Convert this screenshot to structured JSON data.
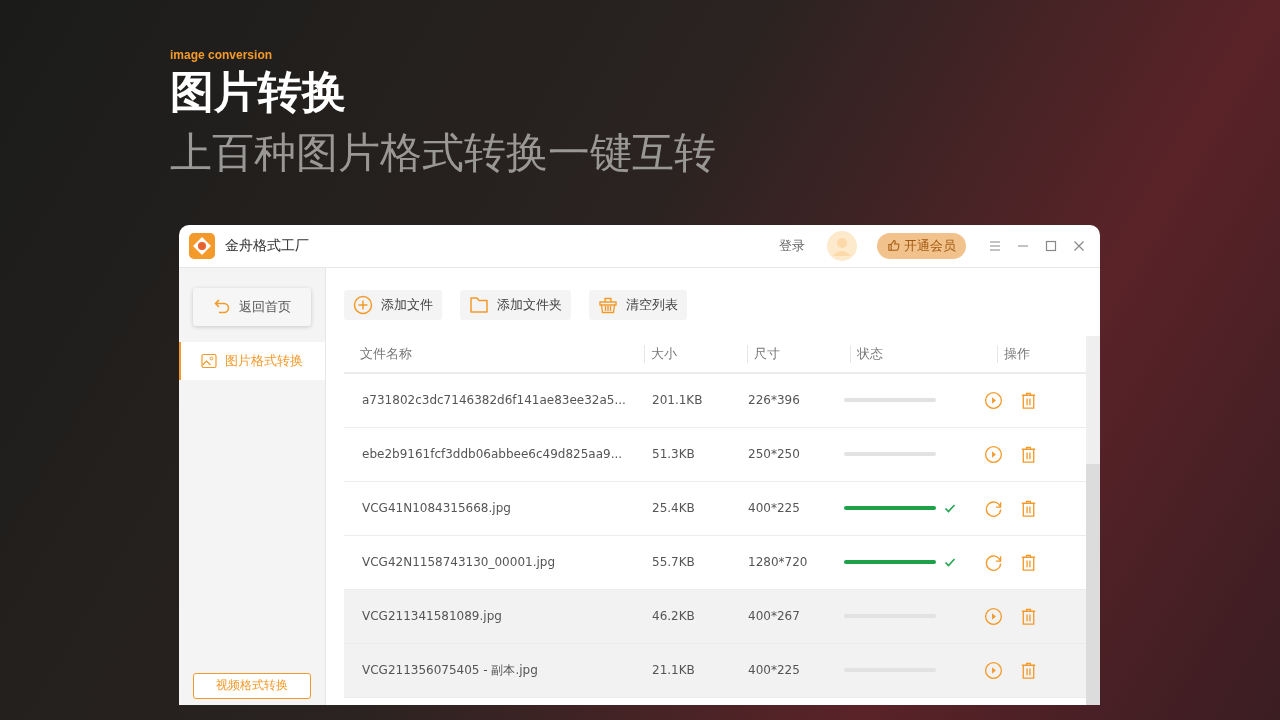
{
  "hero": {
    "eyebrow": "image conversion",
    "title": "图片转换",
    "subtitle": "上百种图片格式转换一键互转"
  },
  "window": {
    "title": "金舟格式工厂",
    "login": "登录",
    "vip_button": "开通会员"
  },
  "sidebar": {
    "back_button": "返回首页",
    "items": [
      {
        "label": "图片格式转换",
        "selected": true
      }
    ],
    "bottom_button": "视频格式转换"
  },
  "toolbar": [
    {
      "kind": "add-file",
      "label": "添加文件"
    },
    {
      "kind": "add-folder",
      "label": "添加文件夹"
    },
    {
      "kind": "clear",
      "label": "清空列表"
    }
  ],
  "table": {
    "columns": [
      "文件名称",
      "大小",
      "尺寸",
      "状态",
      "操作"
    ],
    "rows": [
      {
        "name": "a731802c3dc7146382d6f141ae83ee32a5...",
        "size": "201.1KB",
        "dimensions": "226*396",
        "done": false,
        "selected": false
      },
      {
        "name": "ebe2b9161fcf3ddb06abbee6c49d825aa9...",
        "size": "51.3KB",
        "dimensions": "250*250",
        "done": false,
        "selected": false
      },
      {
        "name": "VCG41N1084315668.jpg",
        "size": "25.4KB",
        "dimensions": "400*225",
        "done": true,
        "selected": false
      },
      {
        "name": "VCG42N1158743130_00001.jpg",
        "size": "55.7KB",
        "dimensions": "1280*720",
        "done": true,
        "selected": false
      },
      {
        "name": "VCG211341581089.jpg",
        "size": "46.2KB",
        "dimensions": "400*267",
        "done": false,
        "selected": true
      },
      {
        "name": "VCG211356075405 - 副本.jpg",
        "size": "21.1KB",
        "dimensions": "400*225",
        "done": false,
        "selected": true
      }
    ]
  }
}
